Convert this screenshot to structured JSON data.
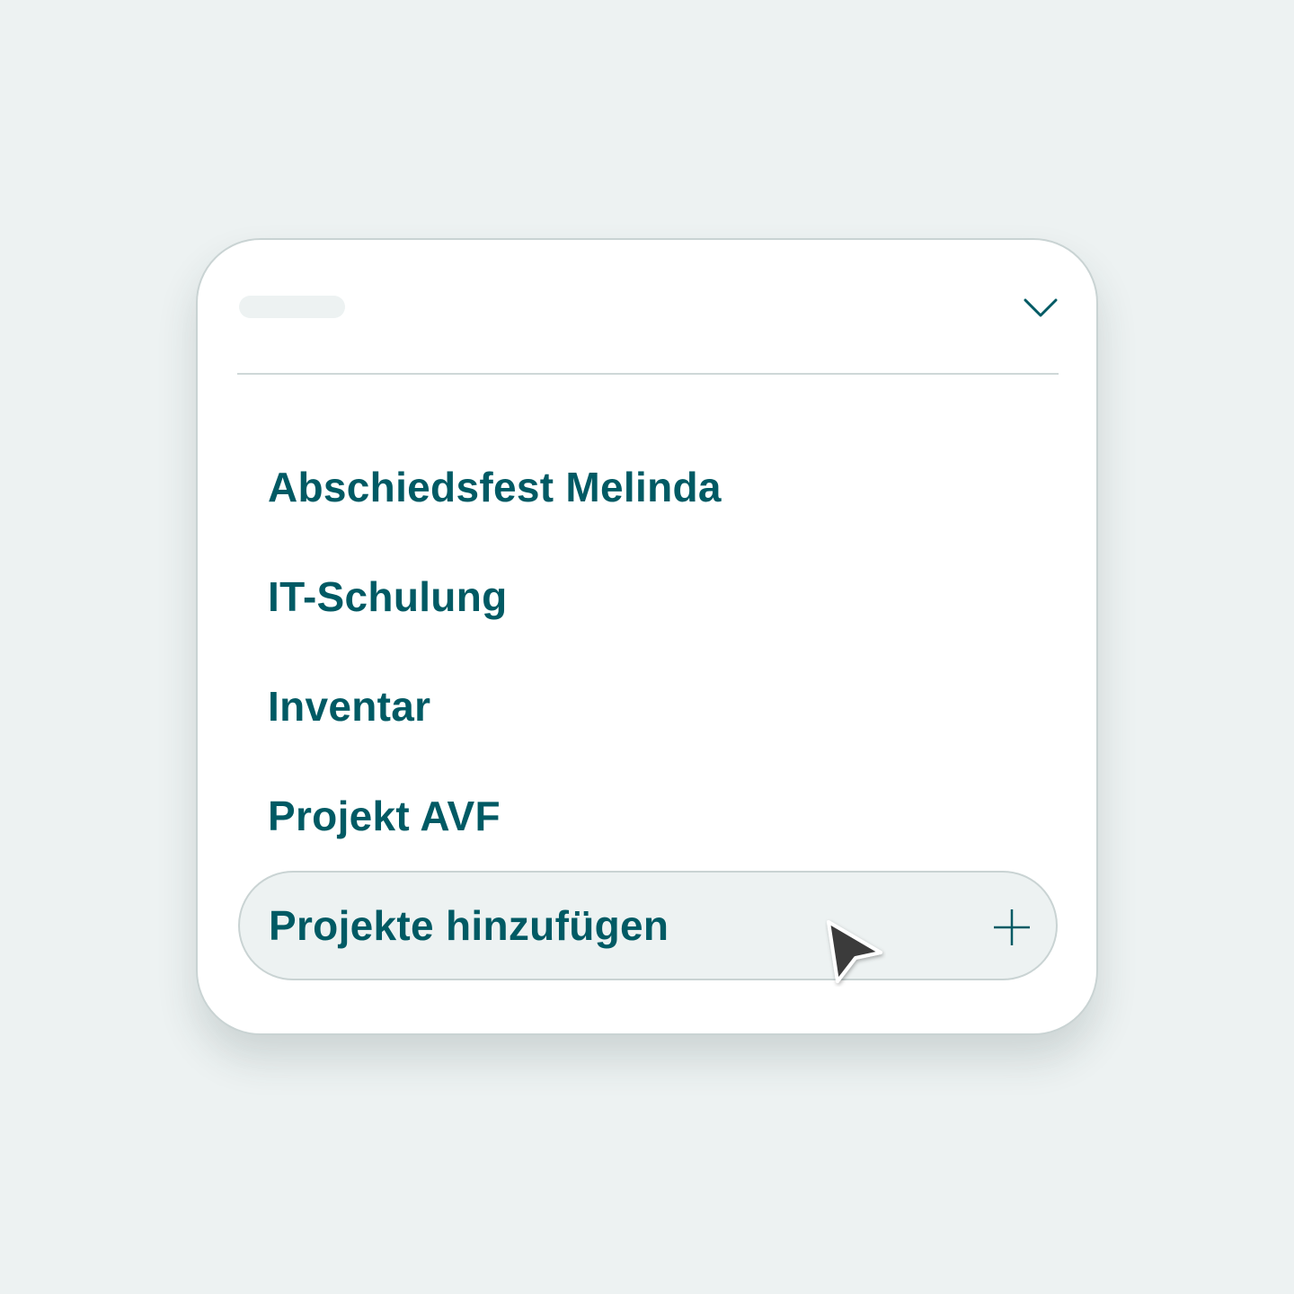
{
  "select": {
    "placeholder_text": "",
    "chevron_icon": "chevron-down-icon"
  },
  "options": [
    {
      "label": "Abschiedsfest Melinda"
    },
    {
      "label": "IT-Schulung"
    },
    {
      "label": "Inventar"
    },
    {
      "label": "Projekt AVF"
    }
  ],
  "add_option": {
    "label": "Projekte hinzufügen",
    "icon": "plus-icon"
  },
  "colors": {
    "background": "#edf2f2",
    "card": "#ffffff",
    "accent_text": "#005a64",
    "border": "#c9d3d3"
  }
}
